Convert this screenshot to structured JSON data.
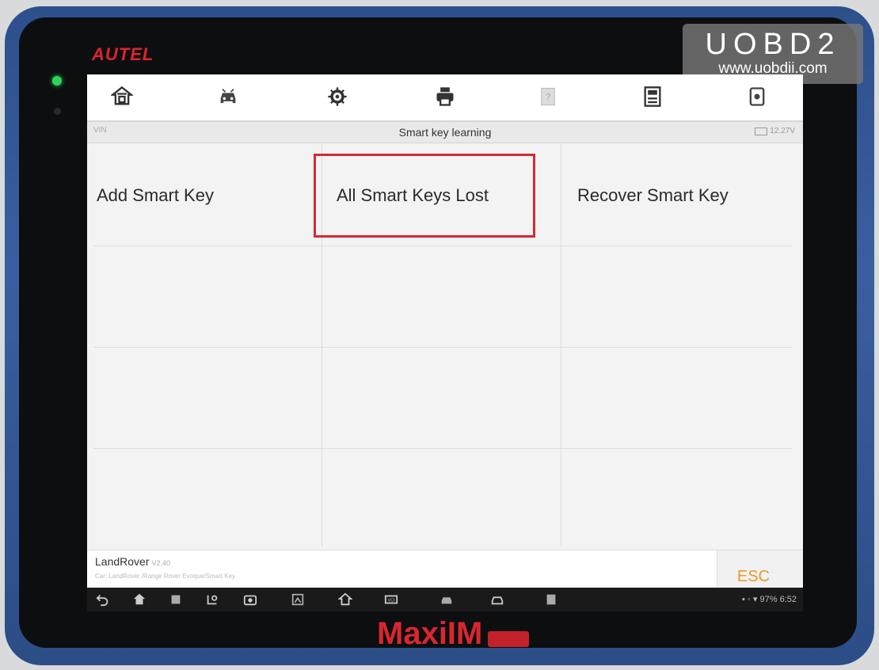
{
  "device": {
    "brand": "AUTEL",
    "model": "MaxiIM",
    "watermark_title": "UOBD2",
    "watermark_url": "www.uobdii.com"
  },
  "toolbar": {
    "icons": [
      "home-icon",
      "vehicle-icon",
      "settings-icon",
      "print-icon",
      "help-icon",
      "save-icon",
      "data-icon"
    ]
  },
  "subheader": {
    "vin_label": "VIN",
    "title": "Smart key learning",
    "voltage": "12.27V"
  },
  "menu": {
    "items": [
      {
        "label": "Add Smart Key"
      },
      {
        "label": "All Smart Keys Lost"
      },
      {
        "label": "Recover Smart Key"
      }
    ]
  },
  "footer": {
    "make": "LandRover",
    "version": "V2.40",
    "path": "Car: LandRover /Range Rover Evoque/Smart Key",
    "esc_label": "ESC"
  },
  "statusbar": {
    "status_text": "97%  6:52"
  },
  "colors": {
    "accent_red": "#d42a33",
    "esc_orange": "#e89a2c",
    "shell_blue": "#2d4f8c"
  }
}
